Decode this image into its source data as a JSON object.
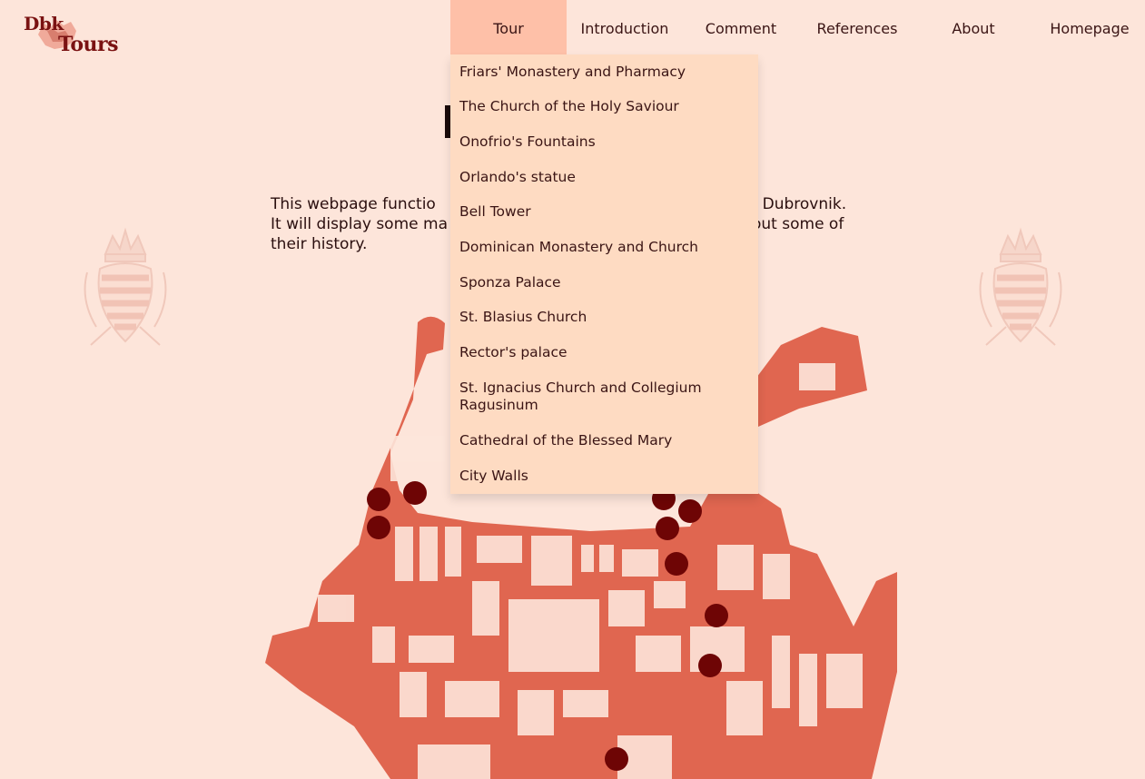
{
  "brand": {
    "line1": "Dbk",
    "line2": "Tours"
  },
  "nav": {
    "items": [
      "Tour",
      "Introduction",
      "Comment",
      "References",
      "About",
      "Homepage"
    ],
    "active": "Tour"
  },
  "dropdown": {
    "items": [
      "Friars' Monastery and Pharmacy",
      "The Church of the Holy Saviour",
      "Onofrio's Fountains",
      "Orlando's statue",
      "Bell Tower",
      "Dominican Monastery and Church",
      "Sponza Palace",
      "St. Blasius Church",
      "Rector's palace",
      "St. Ignacius Church and Collegium Ragusinum",
      "Cathedral of the Blessed Mary",
      "City Walls"
    ]
  },
  "intro": {
    "line1_start": "This webpage functio",
    "line1_end": "of Dubrovnik.",
    "line2_start": "It will display some ma",
    "line2_end": "out some of",
    "line3": "their history."
  },
  "colors": {
    "background": "#fde5da",
    "nav_active": "#fec0a8",
    "dropdown": "#fedbc2",
    "map": "#e06650",
    "marker": "#6e0505",
    "brand": "#7a1212"
  },
  "map": {
    "marker_count": 12
  }
}
